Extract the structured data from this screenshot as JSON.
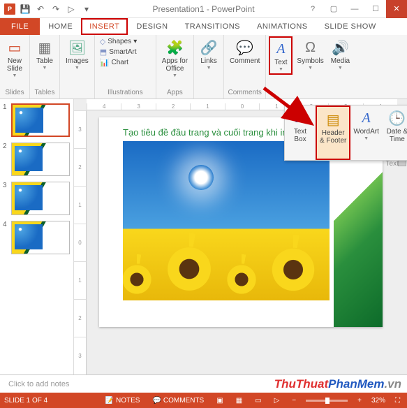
{
  "title": "Presentation1 - PowerPoint",
  "qa": {
    "save": "💾",
    "undo": "↶",
    "redo": "↷",
    "start": "▷"
  },
  "win": {
    "help": "?",
    "opts": "▢",
    "min": "—",
    "max": "☐",
    "close": "✕"
  },
  "tabs": {
    "file": "FILE",
    "home": "HOME",
    "insert": "INSERT",
    "design": "DESIGN",
    "transitions": "TRANSITIONS",
    "animations": "ANIMATIONS",
    "slideshow": "SLIDE SHOW"
  },
  "ribbon": {
    "new_slide": "New\nSlide",
    "slides_grp": "Slides",
    "table": "Table",
    "tables_grp": "Tables",
    "images": "Images",
    "shapes": "Shapes",
    "smartart": "SmartArt",
    "chart": "Chart",
    "illus_grp": "Illustrations",
    "apps": "Apps for\nOffice",
    "apps_grp": "Apps",
    "links": "Links",
    "comment": "Comment",
    "comments_grp": "Comments",
    "text": "Text",
    "symbols": "Symbols",
    "media": "Media"
  },
  "popout": {
    "textbox": "Text\nBox",
    "headerfooter": "Header\n& Footer",
    "wordart": "WordArt",
    "datetime": "Date &\nTime",
    "grp": "Text"
  },
  "ruler_h": [
    "4",
    "3",
    "2",
    "1",
    "0",
    "1",
    "2",
    "3",
    "4"
  ],
  "ruler_v": [
    "3",
    "2",
    "1",
    "0",
    "1",
    "2",
    "3"
  ],
  "thumbs": [
    {
      "n": "1",
      "sel": true
    },
    {
      "n": "2"
    },
    {
      "n": "3"
    },
    {
      "n": "4"
    }
  ],
  "slide": {
    "title": "Tạo tiêu đề đầu trang và cuối trang khi in"
  },
  "notes_placeholder": "Click to add notes",
  "watermark": {
    "a": "ThuThuat",
    "b": "PhanMem",
    "c": ".vn"
  },
  "status": {
    "slide": "SLIDE 1 OF 4",
    "lang": "",
    "notes": "NOTES",
    "comments": "COMMENTS",
    "zoom": "32%"
  }
}
